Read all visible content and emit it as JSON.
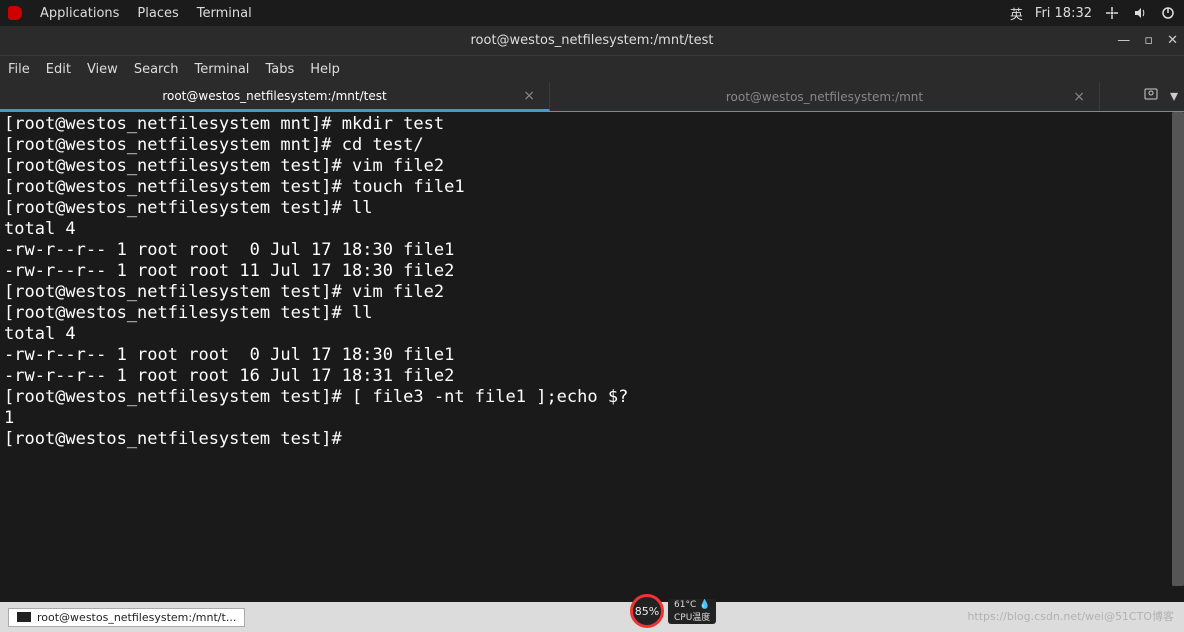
{
  "topbar": {
    "apps": "Applications",
    "places": "Places",
    "terminal": "Terminal",
    "lang": "英",
    "datetime": "Fri 18:32"
  },
  "window": {
    "title": "root@westos_netfilesystem:/mnt/test",
    "minimize": "—",
    "maximize": "▫",
    "close": "✕"
  },
  "menu": {
    "file": "File",
    "edit": "Edit",
    "view": "View",
    "search": "Search",
    "terminal": "Terminal",
    "tabs": "Tabs",
    "help": "Help"
  },
  "tabs": {
    "t1": "root@westos_netfilesystem:/mnt/test",
    "t2": "root@westos_netfilesystem:/mnt",
    "close": "×"
  },
  "terminal": {
    "lines": [
      "[root@westos_netfilesystem mnt]# mkdir test",
      "[root@westos_netfilesystem mnt]# cd test/",
      "[root@westos_netfilesystem test]# vim file2",
      "[root@westos_netfilesystem test]# touch file1",
      "[root@westos_netfilesystem test]# ll",
      "total 4",
      "-rw-r--r-- 1 root root  0 Jul 17 18:30 file1",
      "-rw-r--r-- 1 root root 11 Jul 17 18:30 file2",
      "[root@westos_netfilesystem test]# vim file2",
      "[root@westos_netfilesystem test]# ll",
      "total 4",
      "-rw-r--r-- 1 root root  0 Jul 17 18:30 file1",
      "-rw-r--r-- 1 root root 16 Jul 17 18:31 file2",
      "[root@westos_netfilesystem test]# [ file3 -nt file1 ];echo $?",
      "1",
      "[root@westos_netfilesystem test]# "
    ]
  },
  "taskbar": {
    "item": "root@westos_netfilesystem:/mnt/t..."
  },
  "gauge": {
    "pct": "85%",
    "temp": "61°C 💧",
    "label": "CPU温度"
  },
  "watermark": "https://blog.csdn.net/wei@51CTO博客"
}
